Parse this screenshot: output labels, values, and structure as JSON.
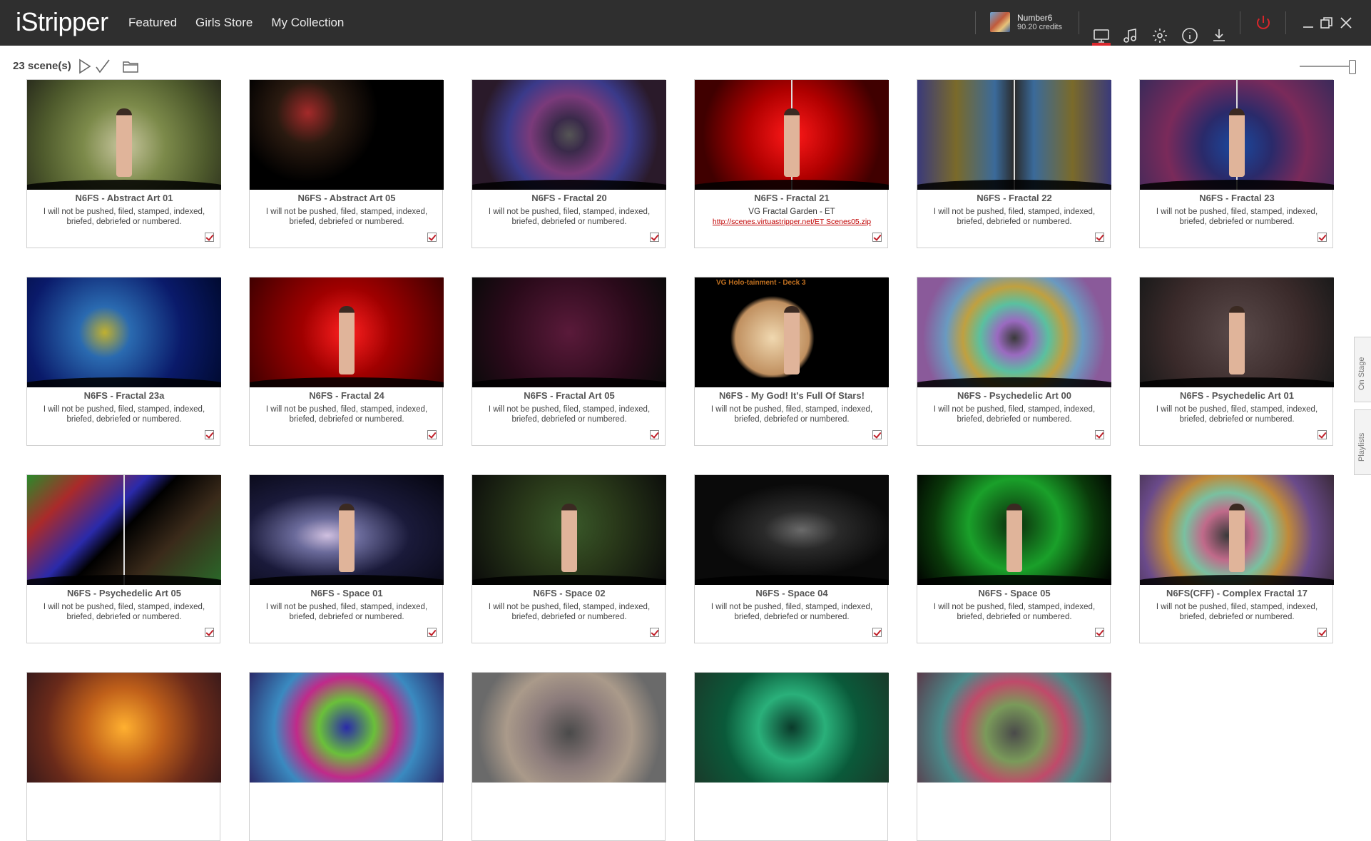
{
  "app": {
    "logo": "iStripper"
  },
  "nav": {
    "featured": "Featured",
    "girls_store": "Girls Store",
    "my_collection": "My Collection"
  },
  "user": {
    "name": "Number6",
    "credits": "90.20 credits"
  },
  "toolbar": {
    "icons": [
      "monitor-icon",
      "music-icon",
      "settings-icon",
      "info-icon",
      "download-icon",
      "power-icon",
      "minimize-icon",
      "restore-icon",
      "close-icon"
    ],
    "active_color": "#d8262b"
  },
  "subbar": {
    "count": "23 scene(s)"
  },
  "side_tabs": {
    "on_stage": "On Stage",
    "playlists": "Playlists"
  },
  "default_desc": "I will not be pushed, filed, stamped, indexed, briefed, debriefed or numbered.",
  "cards": [
    {
      "title": "N6FS - Abstract Art 01",
      "desc": "I will not be pushed, filed, stamped, indexed, briefed, debriefed or numbered.",
      "checked": true
    },
    {
      "title": "N6FS - Abstract Art 05",
      "desc": "I will not be pushed, filed, stamped, indexed, briefed, debriefed or numbered.",
      "checked": true
    },
    {
      "title": "N6FS - Fractal 20",
      "desc": "I will not be pushed, filed, stamped, indexed, briefed, debriefed or numbered.",
      "checked": true
    },
    {
      "title": "N6FS - Fractal 21",
      "desc": "VG Fractal Garden - ET",
      "link": "http://scenes.virtuastripper.net/ET Scenes05.zip",
      "checked": true
    },
    {
      "title": "N6FS - Fractal 22",
      "desc": "I will not be pushed, filed, stamped, indexed, briefed, debriefed or numbered.",
      "checked": true
    },
    {
      "title": "N6FS - Fractal 23",
      "desc": "I will not be pushed, filed, stamped, indexed, briefed, debriefed or numbered.",
      "checked": true
    },
    {
      "title": "N6FS - Fractal 23a",
      "desc": "I will not be pushed, filed, stamped, indexed, briefed, debriefed or numbered.",
      "checked": true
    },
    {
      "title": "N6FS - Fractal 24",
      "desc": "I will not be pushed, filed, stamped, indexed, briefed, debriefed or numbered.",
      "checked": true
    },
    {
      "title": "N6FS - Fractal Art 05",
      "desc": "I will not be pushed, filed, stamped, indexed, briefed, debriefed or numbered.",
      "checked": true
    },
    {
      "title": "N6FS - My God! It's Full Of Stars!",
      "desc": "I will not be pushed, filed, stamped, indexed, briefed, debriefed or numbered.",
      "checked": true,
      "overlay": "VG Holo-tainment - Deck 3"
    },
    {
      "title": "N6FS - Psychedelic Art 00",
      "desc": "I will not be pushed, filed, stamped, indexed, briefed, debriefed or numbered.",
      "checked": true
    },
    {
      "title": "N6FS - Psychedelic Art 01",
      "desc": "I will not be pushed, filed, stamped, indexed, briefed, debriefed or numbered.",
      "checked": true
    },
    {
      "title": "N6FS - Psychedelic Art 05",
      "desc": "I will not be pushed, filed, stamped, indexed, briefed, debriefed or numbered.",
      "checked": true
    },
    {
      "title": "N6FS - Space 01",
      "desc": "I will not be pushed, filed, stamped, indexed, briefed, debriefed or numbered.",
      "checked": true
    },
    {
      "title": "N6FS - Space 02",
      "desc": "I will not be pushed, filed, stamped, indexed, briefed, debriefed or numbered.",
      "checked": true
    },
    {
      "title": "N6FS - Space 04",
      "desc": "I will not be pushed, filed, stamped, indexed, briefed, debriefed or numbered.",
      "checked": true
    },
    {
      "title": "N6FS - Space 05",
      "desc": "I will not be pushed, filed, stamped, indexed, briefed, debriefed or numbered.",
      "checked": true
    },
    {
      "title": "N6FS(CFF) - Complex Fractal 17",
      "desc": "I will not be pushed, filed, stamped, indexed, briefed, debriefed or numbered.",
      "checked": true
    },
    {
      "title": "",
      "desc": "",
      "checked": false
    },
    {
      "title": "",
      "desc": "",
      "checked": false
    },
    {
      "title": "",
      "desc": "",
      "checked": false
    },
    {
      "title": "",
      "desc": "",
      "checked": false
    },
    {
      "title": "",
      "desc": "",
      "checked": false
    }
  ],
  "thumbs": [
    {
      "bg": "radial-gradient(circle at 50% 60%, #c9c7a0 0%, #7c8a4a 35%, #4e5a2c 70%, #2a2d1d 100%)",
      "figure": true,
      "pole": false
    },
    {
      "bg": "radial-gradient(circle at 30% 30%, #a42a2a 0%, #2a1a10 20%, #000 45%), radial-gradient(circle at 70% 20%, #2a9a3a 0%, #000 30%)",
      "figure": false,
      "pole": false
    },
    {
      "bg": "radial-gradient(circle at 50% 50%, #555 0%, #3a2a4a 15%, #7a3a7a 35%, #3a3a8a 55%, #2a1a2a 80%)",
      "figure": false,
      "pole": false
    },
    {
      "bg": "radial-gradient(circle at 50% 50%, #ff1a1a 0%, #b00000 40%, #400000 80%)",
      "figure": true,
      "pole": true
    },
    {
      "bg": "linear-gradient(90deg, #3a3a7a 0%, #7a6a2a 20%, #3a6a9a 40%, #2a2a2a 50%, #3a6a9a 60%, #7a6a2a 80%, #3a3a7a 100%)",
      "figure": false,
      "pole": true
    },
    {
      "bg": "radial-gradient(circle at 50% 60%, #1a4aa0 0%, #2a2a6a 30%, #7a2a5a 60%, #3a2a5a 100%)",
      "figure": true,
      "pole": true
    },
    {
      "bg": "radial-gradient(circle at 40% 50%, #c0b030 0%, #2a6ab0 20%, #0a1a6a 60%, #000a30 100%)",
      "figure": false,
      "pole": false
    },
    {
      "bg": "radial-gradient(circle at 50% 50%, #ff2020 0%, #a00000 40%, #400000 100%)",
      "figure": true,
      "pole": false
    },
    {
      "bg": "radial-gradient(circle at 50% 50%, #5a1a3a 0%, #2a0a1a 60%, #0a0a0a 100%)",
      "figure": false,
      "pole": false
    },
    {
      "bg": "radial-gradient(circle at 40% 55%, #f0d8b0 0%, #c09060 28%, #000 32%)",
      "figure": true,
      "pole": false
    },
    {
      "bg": "radial-gradient(circle at 50% 55%, #3a3a3a 0%, #9a6ac0 15%, #5ac0a0 30%, #c0a040 45%, #6a9ac0 60%, #8a5a9a 80%)",
      "figure": false,
      "pole": false
    },
    {
      "bg": "radial-gradient(circle at 50% 50%, #5a4a4a 0%, #3a2a2a 60%, #1a1a1a 100%)",
      "figure": true,
      "pole": false
    },
    {
      "bg": "linear-gradient(135deg, #2a8a2a 0%, #aa2a2a 20%, #2a2aaa 40%, #000 50%, #3a2a1a 70%, #2a6a2a 100%)",
      "figure": false,
      "pole": true
    },
    {
      "bg": "radial-gradient(ellipse at 40% 55%, #d0c0e0 0%, #6a6a9a 20%, #1a1a3a 50%, #05050f 100%)",
      "figure": true,
      "pole": false
    },
    {
      "bg": "radial-gradient(circle at 50% 45%, #3a5a2a 0%, #2a3a1a 40%, #0a0a0a 100%)",
      "figure": true,
      "pole": false
    },
    {
      "bg": "radial-gradient(ellipse at 55% 50%, #6a6a6a 0%, #2a2a2a 25%, #0a0a0a 60%)",
      "figure": false,
      "pole": false
    },
    {
      "bg": "radial-gradient(circle at 50% 45%, #0a2a0a 0%, #1aa02a 40%, #0a3a0a 70%, #000 100%)",
      "figure": true,
      "pole": false
    },
    {
      "bg": "radial-gradient(circle at 45% 55%, #3a3a3a 0%, #c06a8a 20%, #7ac0a0 35%, #c08a3a 50%, #6a4a8a 70%, #3a2a3a 100%)",
      "figure": true,
      "pole": false
    },
    {
      "bg": "radial-gradient(circle at 50% 50%, #ffb030 0%, #c0601a 35%, #6a2a1a 70%, #3a1a1a 100%)",
      "figure": false,
      "pole": false
    },
    {
      "bg": "radial-gradient(circle at 50% 50%, #2a2aaa 0%, #6ac03a 25%, #c02a8a 45%, #3a8ac0 65%, #2a2a6a 100%)",
      "figure": false,
      "pole": false
    },
    {
      "bg": "radial-gradient(circle at 50% 55%, #4a4a4a 0%, #8a7a7a 30%, #aa9a8a 55%, #6a6a6a 80%)",
      "figure": false,
      "pole": false
    },
    {
      "bg": "radial-gradient(circle at 50% 50%, #0a3a2a 0%, #2ab07a 30%, #0a5a3a 60%, #1a3a2a 100%)",
      "figure": false,
      "pole": false
    },
    {
      "bg": "radial-gradient(circle at 50% 55%, #4a4a4a 0%, #7a9a5a 25%, #c04a6a 45%, #4a8a8a 65%, #5a3a4a 100%)",
      "figure": false,
      "pole": false
    }
  ]
}
